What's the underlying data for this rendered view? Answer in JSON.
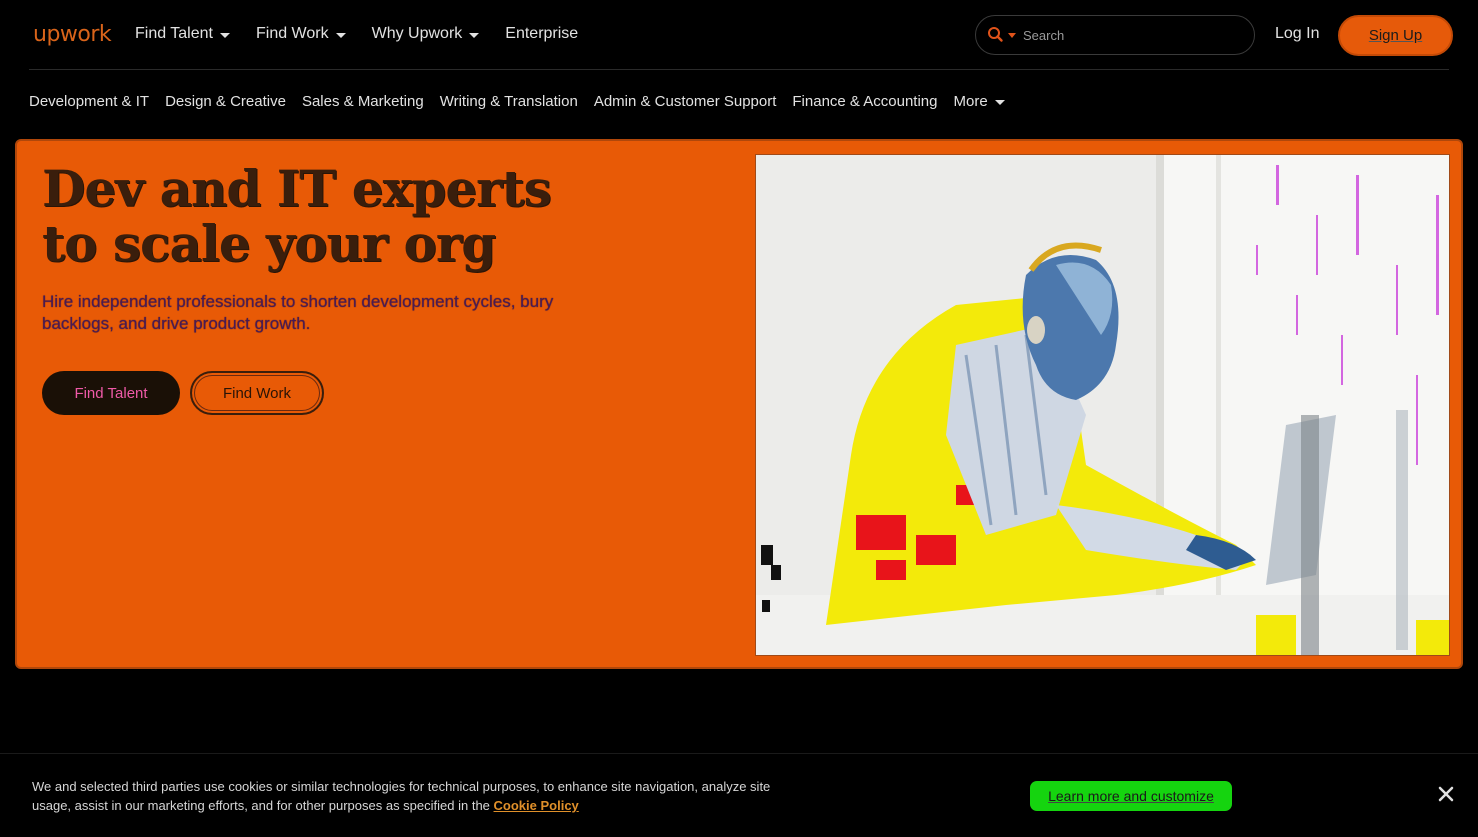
{
  "header": {
    "logo": "upwork",
    "nav": [
      {
        "label": "Find Talent",
        "has_caret": true
      },
      {
        "label": "Find Work",
        "has_caret": true
      },
      {
        "label": "Why Upwork",
        "has_caret": true
      },
      {
        "label": "Enterprise",
        "has_caret": false
      }
    ],
    "search_placeholder": "Search",
    "login_label": "Log In",
    "signup_label": "Sign Up"
  },
  "categories": [
    "Development & IT",
    "Design & Creative",
    "Sales & Marketing",
    "Writing & Translation",
    "Admin & Customer Support",
    "Finance & Accounting",
    "More"
  ],
  "hero": {
    "title": "Dev and IT experts to scale your org",
    "subtitle": "Hire independent professionals to shorten development cycles, bury backlogs, and drive product growth.",
    "find_talent_label": "Find Talent",
    "find_work_label": "Find Work"
  },
  "cookie": {
    "text": "We and selected third parties use cookies or similar technologies for technical purposes, to enhance site navigation, analyze site usage, assist in our marketing efforts, and for other purposes as specified in the",
    "link_label": "Cookie Policy",
    "learn_more_label": "Learn more and customize"
  },
  "colors": {
    "brand": "#e65a0a",
    "hero_bg": "#e85a06",
    "accept_green": "#15d40f"
  }
}
